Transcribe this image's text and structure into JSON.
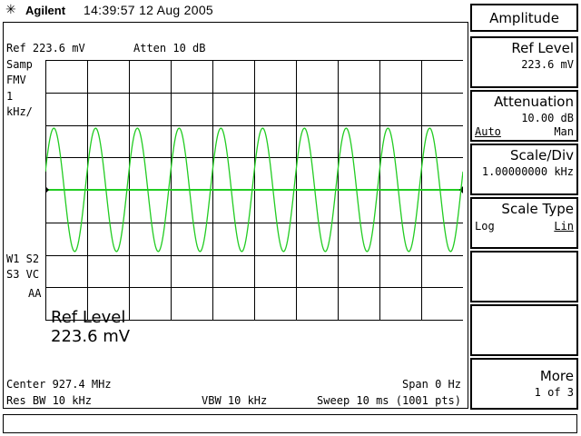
{
  "header": {
    "brand": "Agilent",
    "timestamp": "14:39:57  12 Aug 2005"
  },
  "display": {
    "ref_label": "Ref 223.6 mV",
    "atten_label": "Atten 10 dB",
    "left_annotations": [
      "Samp",
      "FMV",
      "1",
      "kHz/"
    ],
    "trace_annotations": [
      "W1  S2",
      "S3  VC",
      "AA"
    ],
    "overlay_line1": "Ref Level",
    "overlay_line2": "223.6 mV",
    "center": "Center 927.4 MHz",
    "span": "Span 0 Hz",
    "res_bw": "Res BW 10 kHz",
    "vbw": "VBW 10 kHz",
    "sweep": "Sweep 10 ms (1001 pts)",
    "trace": {
      "cycles": 10,
      "phase_offset": 0.3,
      "amplitude_divisions": 1.9,
      "trace_color": "#22cc22",
      "center_line_color": "#22cc22",
      "grid_color": "#000000"
    }
  },
  "menu": {
    "title": "Amplitude",
    "softkeys": [
      {
        "label": "Ref Level",
        "value": "223.6 mV"
      },
      {
        "label": "Attenuation",
        "value": "10.00 dB",
        "opt_left": "Auto",
        "opt_right": "Man"
      },
      {
        "label": "Scale/Div",
        "value": "1.00000000 kHz"
      },
      {
        "label": "Scale Type",
        "opt_left": "Log",
        "opt_right": "Lin"
      },
      {
        "label": ""
      },
      {
        "label": ""
      },
      {
        "label": "More",
        "value": "1 of 3"
      }
    ]
  },
  "status_bar": {
    "message": ""
  }
}
